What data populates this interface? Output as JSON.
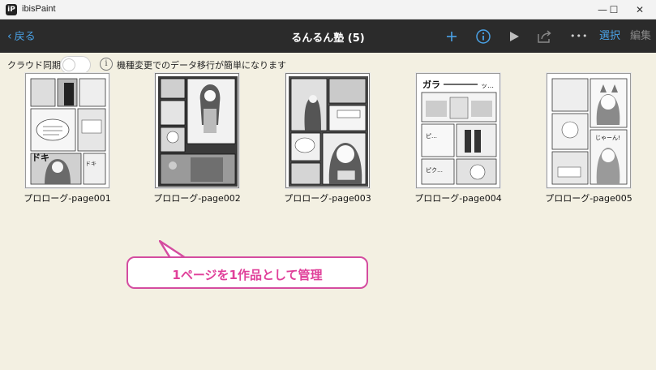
{
  "window": {
    "title": "ibisPaint",
    "icon_label": "iP",
    "minimize_glyph": "—",
    "maximize_glyph": "☐",
    "close_glyph": "✕"
  },
  "toolbar": {
    "back_label": "戻る",
    "back_glyph": "‹",
    "title": "るんるん塾 (5)",
    "icons": [
      "add-icon",
      "info-icon",
      "play-icon",
      "share-icon",
      "more-icon"
    ],
    "more_glyph": "•••",
    "select_label": "選択",
    "edit_label": "編集",
    "accent": "#4aa3e8",
    "background": "#2b2b2b"
  },
  "sync": {
    "label": "クラウド同期",
    "enabled": false,
    "info_glyph": "i",
    "hint": "機種変更でのデータ移行が簡単になります"
  },
  "artworks": [
    {
      "name": "プロローグ-page001",
      "selected": false
    },
    {
      "name": "プロローグ-page002",
      "selected": true
    },
    {
      "name": "プロローグ-page003",
      "selected": true
    },
    {
      "name": "プロローグ-page004",
      "selected": false
    },
    {
      "name": "プロローグ-page005",
      "selected": false
    }
  ],
  "callout": {
    "text": "1ページを1作品として管理",
    "color": "#e0409a"
  },
  "colors": {
    "page_background": "#f3f0e2",
    "titlebar": "#f3f3f3"
  }
}
